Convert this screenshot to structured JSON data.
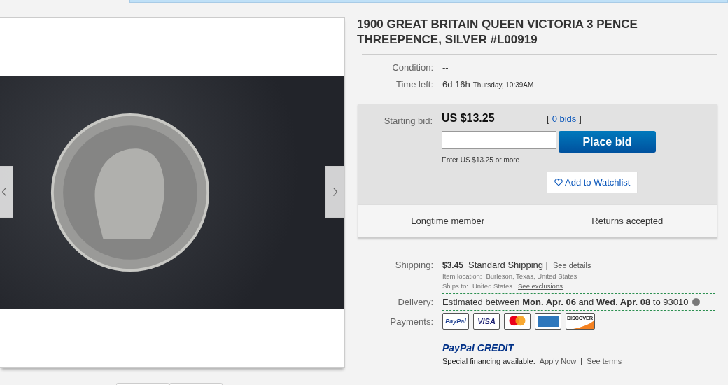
{
  "title": "1900 GREAT BRITAIN QUEEN VICTORIA 3 PENCE THREEPENCE, SILVER #L00919",
  "condition": {
    "label": "Condition:",
    "value": "--"
  },
  "time_left": {
    "label": "Time left:",
    "value": "6d 16h",
    "end": "Thursday, 10:39AM"
  },
  "bid": {
    "label": "Starting bid:",
    "price": "US $13.25",
    "bids_open": "[",
    "bids": "0 bids",
    "bids_close": "]",
    "button": "Place bid",
    "hint": "Enter US $13.25 or more",
    "watchlist": "Add to Watchlist"
  },
  "badges": [
    "Longtime member",
    "Returns accepted"
  ],
  "shipping": {
    "label": "Shipping:",
    "cost": "$3.45",
    "service": "Standard Shipping |",
    "details_link": "See details",
    "location_label": "Item location:",
    "location": "Burleson, Texas, United States",
    "ships_label": "Ships to:",
    "ships_to": "United States",
    "exclusions_link": "See exclusions"
  },
  "delivery": {
    "label": "Delivery:",
    "text": "Estimated between **Mon. Apr. 06** and **Wed. Apr. 08** to 93010"
  },
  "payments": {
    "label": "Payments:",
    "methods": [
      {
        "kind": "paypal",
        "label": "PayPal"
      },
      {
        "kind": "visa",
        "label": "VISA"
      },
      {
        "kind": "mastercard"
      },
      {
        "kind": "amex"
      },
      {
        "kind": "discover",
        "label": "DISCOVER"
      }
    ]
  },
  "credit": {
    "logo_a": "PayPal",
    "logo_b": "CREDIT",
    "text": "Special financing available.",
    "apply_link": "Apply Now",
    "sep": "|",
    "terms_link": "See terms"
  }
}
